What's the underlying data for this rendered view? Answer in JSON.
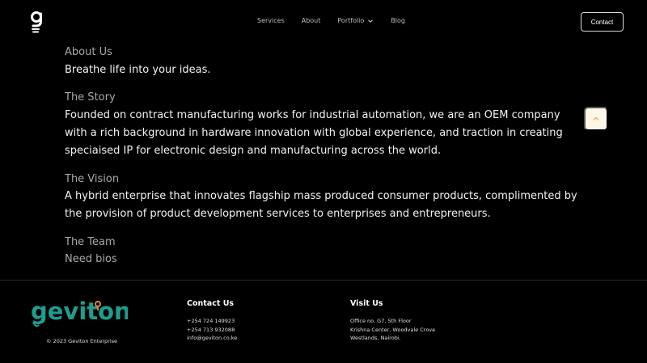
{
  "header": {
    "logo_icon": "geviton-g-icon",
    "nav": [
      {
        "label": "Services"
      },
      {
        "label": "About"
      },
      {
        "label": "Portfolio",
        "icon": "chevron-down-icon"
      },
      {
        "label": "Blog"
      }
    ],
    "contact_label": "Contact"
  },
  "content": {
    "about": {
      "title": "About Us",
      "body": "Breathe life into your ideas."
    },
    "story": {
      "title": "The Story",
      "body": "Founded on contract manufacturing works for industrial automation, we are an OEM company with a rich background in hardware innovation with global experience, and traction in creating speciaised IP for electronic design and manufacturing across the world."
    },
    "vision": {
      "title": "The Vision",
      "body": "A hybrid enterprise that innovates flagship mass produced consumer products, complimented by the provision of product development services to enterprises and entrepreneurs."
    },
    "team": {
      "title": "The Team",
      "body": "Need bios"
    }
  },
  "scroll_top_icon": "chevron-up-icon",
  "footer": {
    "logo_text": "geviton",
    "copyright": "© 2023 Geviton Enterprise",
    "contact": {
      "title": "Contact Us",
      "lines": [
        "+254 724 149923",
        "+254 713 932088",
        "info@geviton.co.ke"
      ]
    },
    "visit": {
      "title": "Visit Us",
      "lines": [
        "Office no. G7, 5th Floor",
        "Krishna Center, Woodvale Crove",
        "Westlands, Nairobi."
      ]
    }
  },
  "colors": {
    "background": "#000000",
    "brand_teal": "#1f9c8f",
    "brand_orange": "#e8832a",
    "scroll_button_bg": "#fff6ea",
    "scroll_icon": "#e8a24a"
  }
}
